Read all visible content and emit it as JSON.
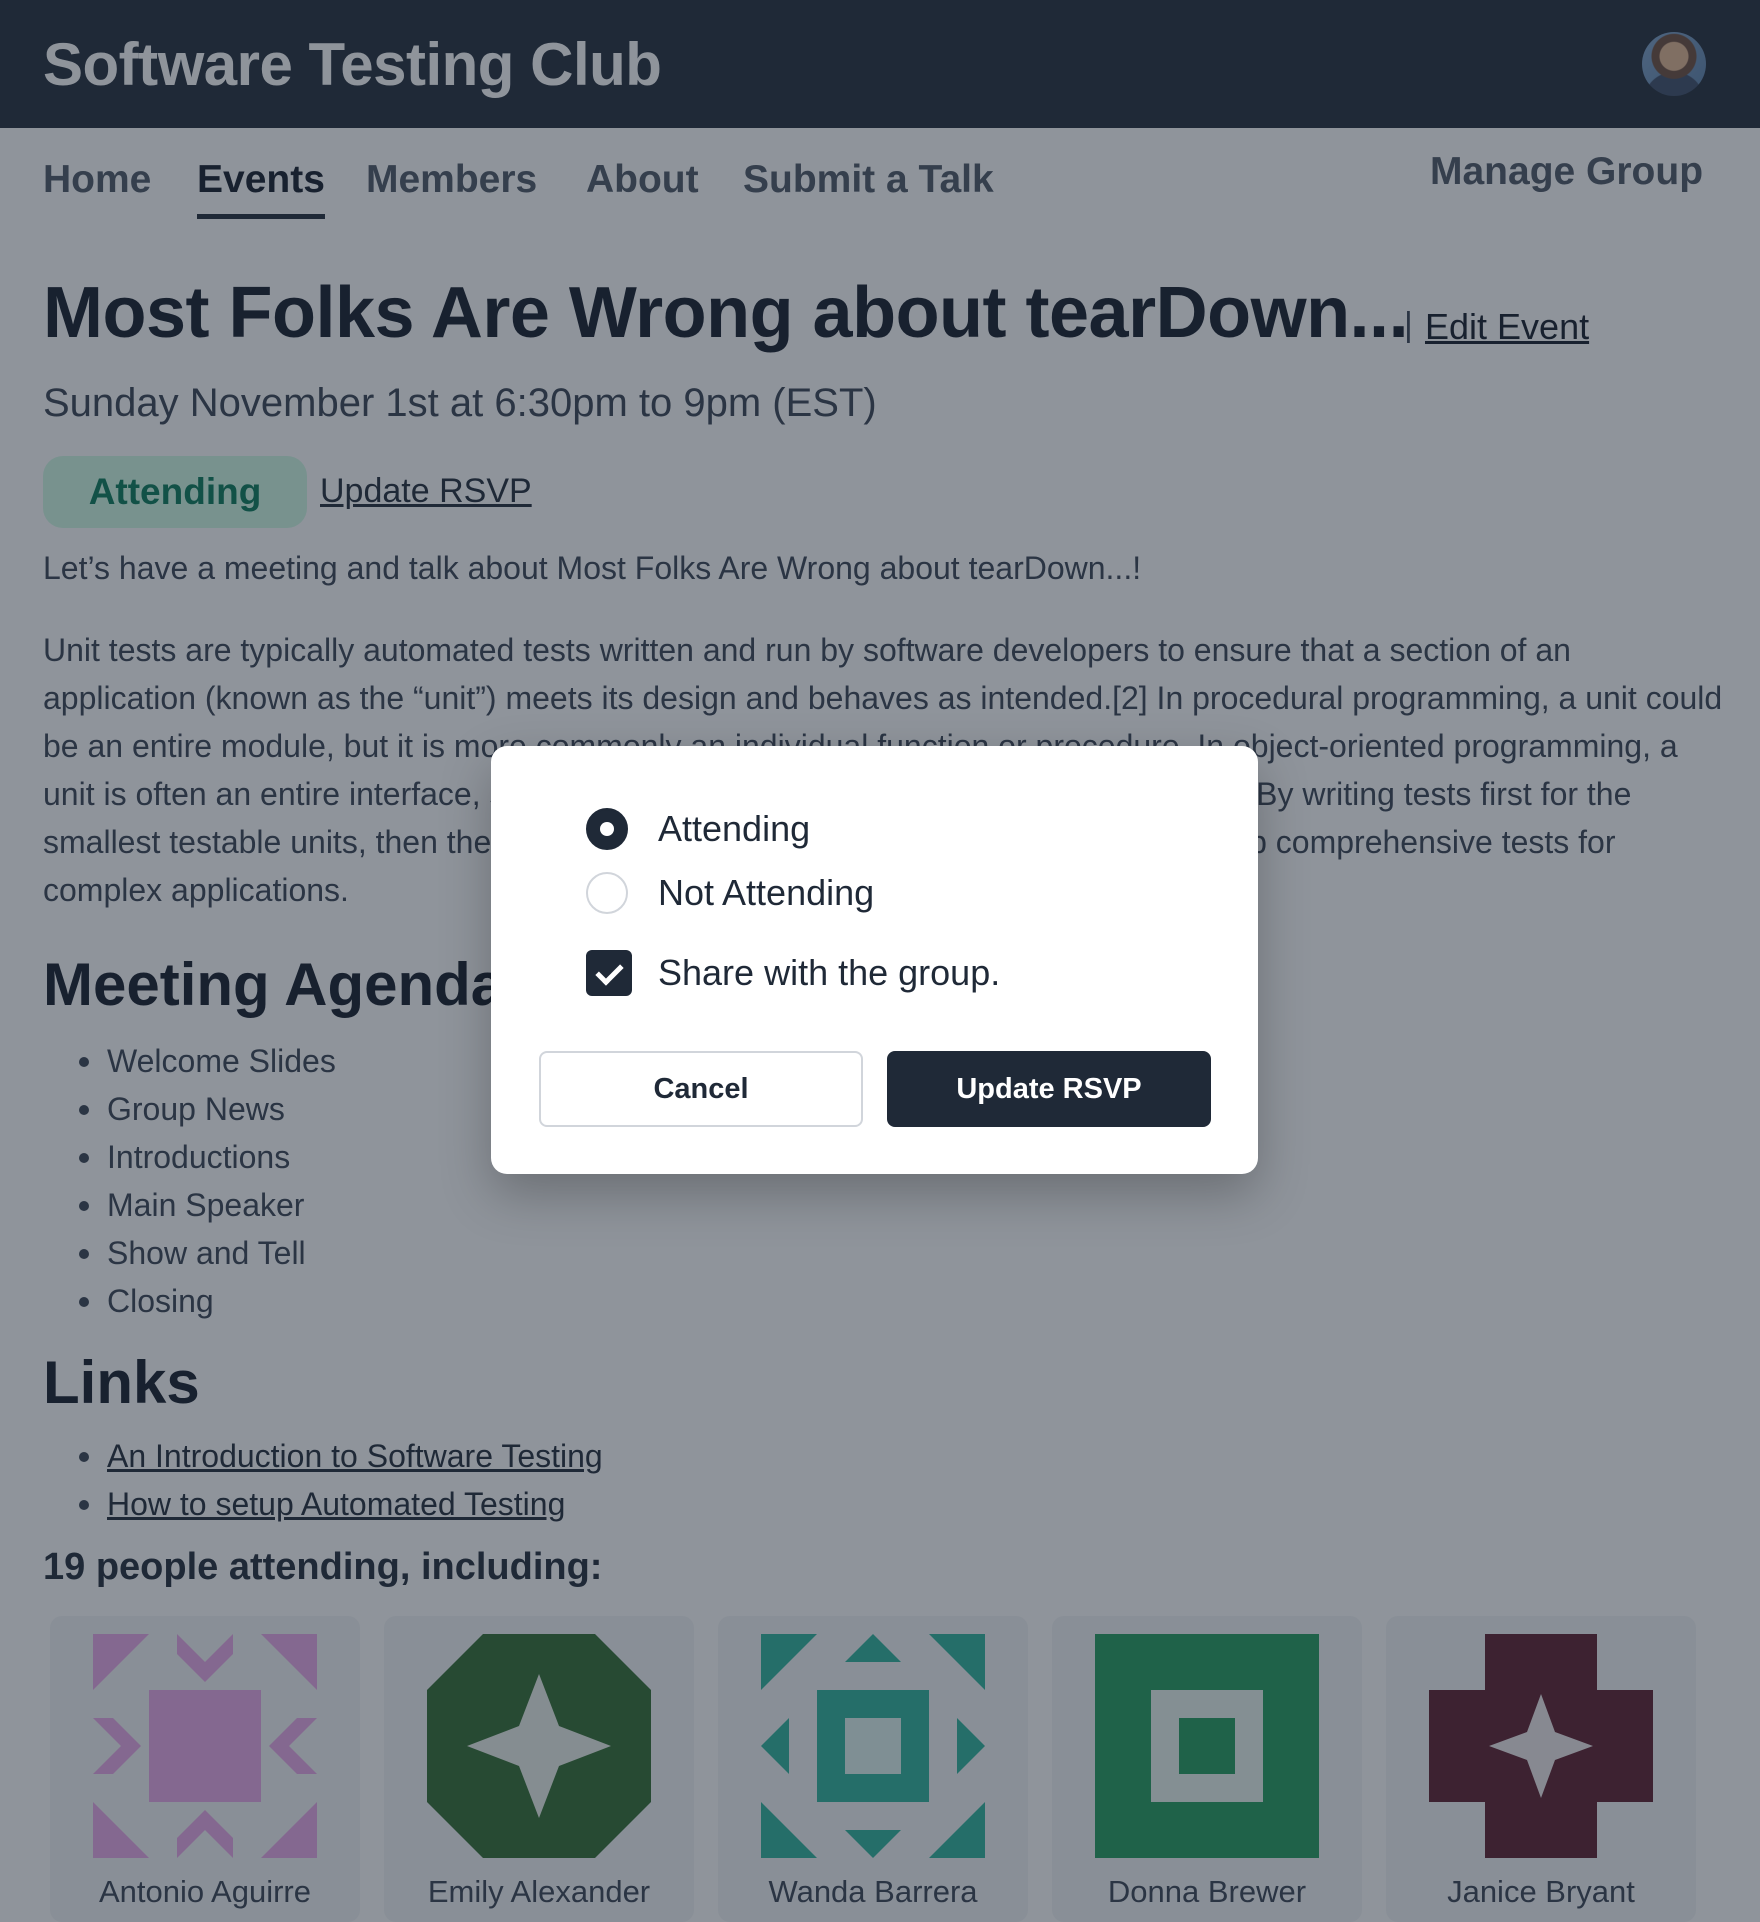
{
  "header": {
    "brand": "Software Testing Club",
    "avatar_icon": "user-avatar"
  },
  "nav": {
    "items": [
      {
        "label": "Home",
        "active": false
      },
      {
        "label": "Events",
        "active": true
      },
      {
        "label": "Members",
        "active": false
      },
      {
        "label": "About",
        "active": false
      },
      {
        "label": "Submit a Talk",
        "active": false
      }
    ],
    "manage_label": "Manage Group"
  },
  "event": {
    "title": "Most Folks Are Wrong about tearDown...",
    "edit_separator": "|",
    "edit_label": "Edit Event",
    "date": "Sunday November 1st at 6:30pm to 9pm (EST)",
    "status_badge": "Attending",
    "update_rsvp_link": "Update RSVP",
    "intro": "Let’s have a meeting and talk about Most Folks Are Wrong about tearDown...!",
    "description": "Unit tests are typically automated tests written and run by software developers to ensure that a section of an application (known as the “unit”) meets its design and behaves as intended.[2] In procedural programming, a unit could be an entire module, but it is more commonly an individual function or procedure. In object-oriented programming, a unit is often an entire interface, such as a class, but could be an individual method.[3] By writing tests first for the smallest testable units, then the compound behaviors between those, one can build up comprehensive tests for complex applications."
  },
  "agenda": {
    "heading": "Meeting Agenda",
    "items": [
      "Welcome Slides",
      "Group News",
      "Introductions",
      "Main Speaker",
      "Show and Tell",
      "Closing"
    ]
  },
  "links": {
    "heading": "Links",
    "items": [
      "An Introduction to Software Testing",
      "How to setup Automated Testing"
    ]
  },
  "attendees": {
    "heading": "19 people attending, including:",
    "people": [
      {
        "name": "Antonio Aguirre",
        "color": "#e9a6e8"
      },
      {
        "name": "Emily Alexander",
        "color": "#2f6b2e"
      },
      {
        "name": "Wanda Barrera",
        "color": "#2bb39a"
      },
      {
        "name": "Donna Brewer",
        "color": "#1f9a5b"
      },
      {
        "name": "Janice Bryant",
        "color": "#5a1a2b"
      }
    ]
  },
  "modal": {
    "options": [
      {
        "label": "Attending",
        "selected": true
      },
      {
        "label": "Not Attending",
        "selected": false
      }
    ],
    "share_label": "Share with the group.",
    "share_checked": true,
    "cancel_label": "Cancel",
    "update_label": "Update RSVP"
  }
}
